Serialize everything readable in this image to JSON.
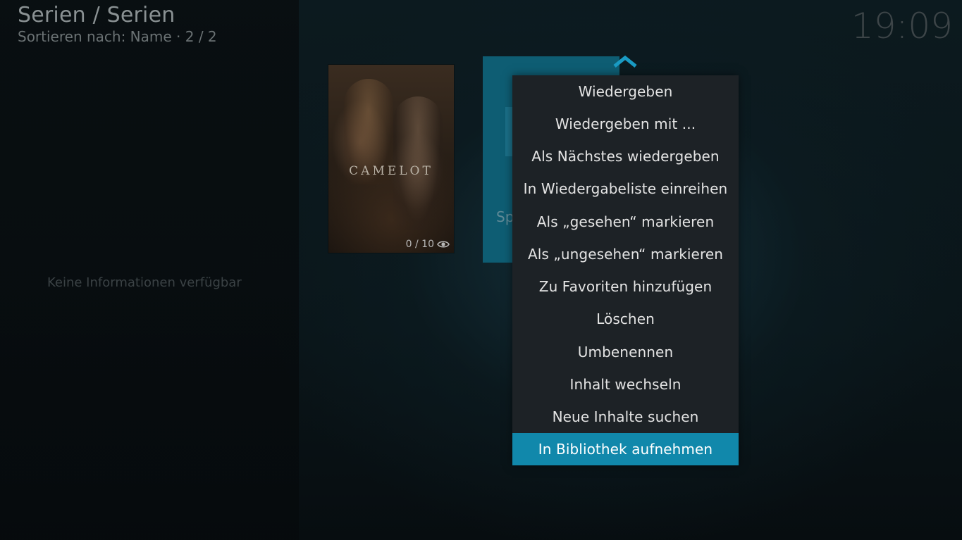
{
  "header": {
    "title": "Serien / Serien",
    "subtitle": "Sortieren nach: Name  ·  2 / 2",
    "clock": "19:09"
  },
  "info_panel": {
    "message": "Keine Informationen verfügbar"
  },
  "items": [
    {
      "poster_title": "CAMELOT",
      "watched_count": "0 / 10",
      "icon": "eye-icon"
    },
    {
      "label_partial": "Sp",
      "icon": "folder-icon"
    }
  ],
  "context_menu": {
    "items": [
      {
        "label": "Wiedergeben"
      },
      {
        "label": "Wiedergeben mit ..."
      },
      {
        "label": "Als Nächstes wiedergeben"
      },
      {
        "label": "In Wiedergabeliste einreihen"
      },
      {
        "label": "Als „gesehen“ markieren"
      },
      {
        "label": "Als „ungesehen“ markieren"
      },
      {
        "label": "Zu Favoriten hinzufügen"
      },
      {
        "label": "Löschen"
      },
      {
        "label": "Umbenennen"
      },
      {
        "label": "Inhalt wechseln"
      },
      {
        "label": "Neue Inhalte suchen"
      },
      {
        "label": "In Bibliothek aufnehmen"
      }
    ],
    "selected_index": 11
  },
  "colors": {
    "accent": "#1188ab",
    "menu_bg": "#1d2226",
    "folder_tile": "#0e5d73"
  }
}
